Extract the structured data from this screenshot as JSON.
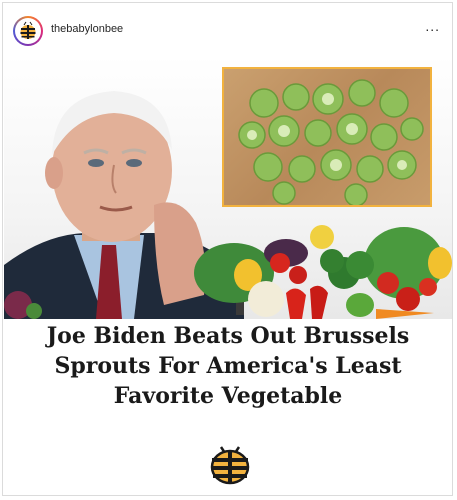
{
  "header": {
    "username": "thebabylonbee",
    "more_label": "..."
  },
  "post": {
    "headline": "Joe Biden Beats Out Brussels Sprouts For America's Least Favorite Vegetable"
  },
  "icons": {
    "avatar": "babylon-bee-logo-icon",
    "more": "more-options-icon",
    "bottom_logo": "babylon-bee-logo-icon"
  },
  "colors": {
    "bee_yellow": "#f2b23e",
    "ring": "#dd2a7b"
  }
}
